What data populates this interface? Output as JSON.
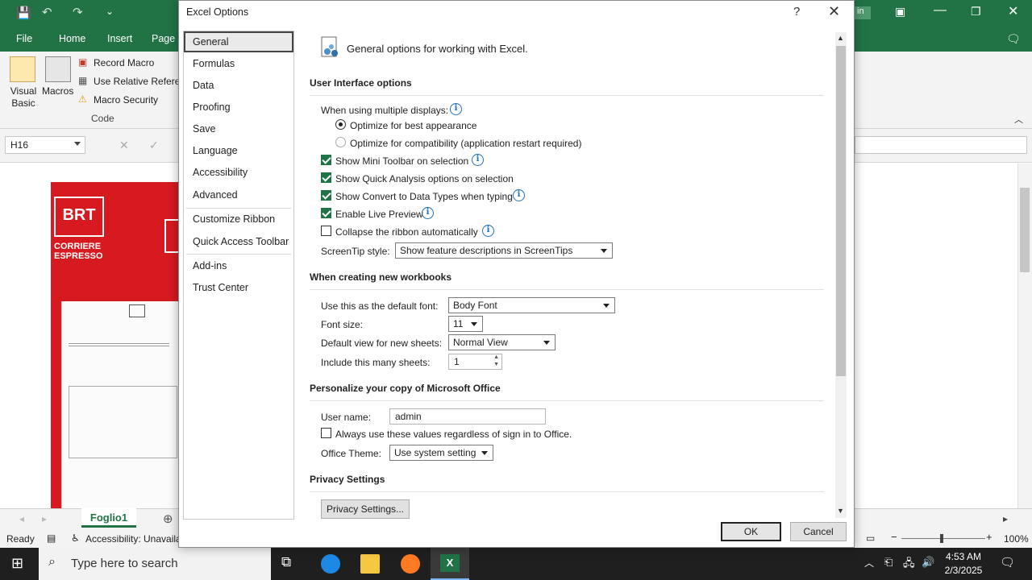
{
  "excel": {
    "tabs": [
      "File",
      "Home",
      "Insert",
      "Page L"
    ],
    "signin_label": "in",
    "ribbon": {
      "visual_basic": "Visual\nBasic",
      "macros": "Macros",
      "record_macro": "Record Macro",
      "relative_refs": "Use Relative Refere",
      "macro_security": "Macro Security",
      "group_code": "Code"
    },
    "name_box": "H16",
    "sheet_tab": "Foglio1",
    "status_ready": "Ready",
    "status_accessibility": "Accessibility: Unavaila",
    "zoom": "100%",
    "brt_logo": "BRT",
    "brt_line1": "CORRIERE",
    "brt_line2": "ESPRESSO",
    "accent_color": "#217346"
  },
  "dialog": {
    "title": "Excel Options",
    "help": "?",
    "close": "✕",
    "nav": [
      "General",
      "Formulas",
      "Data",
      "Proofing",
      "Save",
      "Language",
      "Accessibility",
      "Advanced",
      "Customize Ribbon",
      "Quick Access Toolbar",
      "Add-ins",
      "Trust Center"
    ],
    "selected_nav": "General",
    "header": "General options for working with Excel.",
    "ui_options": {
      "title": "User Interface options",
      "multiple_displays": "When using multiple displays:",
      "optimize_appearance": "Optimize for best appearance",
      "optimize_compat": "Optimize for compatibility (application restart required)",
      "mini_toolbar": "Show Mini Toolbar on selection",
      "quick_analysis": "Show Quick Analysis options on selection",
      "convert_data_types": "Show Convert to Data Types when typing",
      "live_preview": "Enable Live Preview",
      "collapse_ribbon": "Collapse the ribbon automatically",
      "screentip_label": "ScreenTip style:",
      "screentip_value": "Show feature descriptions in ScreenTips"
    },
    "new_workbooks": {
      "title": "When creating new workbooks",
      "default_font_label": "Use this as the default font:",
      "default_font_value": "Body Font",
      "font_size_label": "Font size:",
      "font_size_value": "11",
      "default_view_label": "Default view for new sheets:",
      "default_view_value": "Normal View",
      "sheets_label": "Include this many sheets:",
      "sheets_value": "1"
    },
    "personalize": {
      "title": "Personalize your copy of Microsoft Office",
      "username_label": "User name:",
      "username_value": "admin",
      "always_use": "Always use these values regardless of sign in to Office.",
      "theme_label": "Office Theme:",
      "theme_value": "Use system setting"
    },
    "privacy": {
      "title": "Privacy Settings",
      "button": "Privacy Settings..."
    },
    "ok": "OK",
    "cancel": "Cancel"
  },
  "taskbar": {
    "search_placeholder": "Type here to search",
    "time": "4:53 AM",
    "date": "2/3/2025"
  }
}
